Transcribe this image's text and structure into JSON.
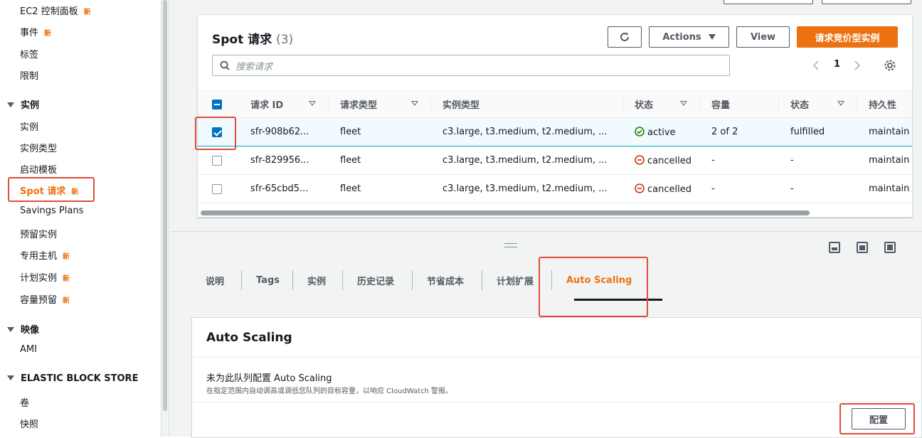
{
  "sidebar": {
    "items": {
      "ec2_dashboard": "EC2 控制面板",
      "events": "事件",
      "tags": "标签",
      "limits": "限制",
      "instances": "实例",
      "instance_types": "实例类型",
      "launch_templates": "启动模板",
      "spot_requests": "Spot 请求",
      "savings_plans": "Savings Plans",
      "reserved_instances": "预留实例",
      "dedicated_hosts": "专用主机",
      "scheduled_instances": "计划实例",
      "capacity_reservations": "容量预留",
      "ami": "AMI",
      "volumes": "卷",
      "snapshots": "快照"
    },
    "sections": {
      "instances": "实例",
      "images": "映像",
      "ebs": "ELASTIC BLOCK STORE"
    },
    "new_badge": "新"
  },
  "spot_panel": {
    "title": "Spot 请求",
    "count": "(3)",
    "actions_label": "Actions",
    "view_label": "View",
    "request_label": "请求竞价型实例",
    "search_placeholder": "搜索请求",
    "page": "1"
  },
  "table": {
    "headers": {
      "request_id": "请求 ID",
      "request_type": "请求类型",
      "instance_type": "实例类型",
      "state": "状态",
      "capacity": "容量",
      "status": "状态",
      "persistence": "持久性"
    },
    "rows": [
      {
        "id": "sfr-908b62...",
        "type": "fleet",
        "instance_types": "c3.large, t3.medium, t2.medium, ...",
        "state": "active",
        "capacity": "2 of 2",
        "status": "fulfilled",
        "persistence": "maintain"
      },
      {
        "id": "sfr-829956...",
        "type": "fleet",
        "instance_types": "c3.large, t3.medium, t2.medium, ...",
        "state": "cancelled",
        "capacity": "-",
        "status": "-",
        "persistence": "maintain"
      },
      {
        "id": "sfr-65cbd5...",
        "type": "fleet",
        "instance_types": "c3.large, t3.medium, t2.medium, ...",
        "state": "cancelled",
        "capacity": "-",
        "status": "-",
        "persistence": "maintain"
      }
    ]
  },
  "tabs": {
    "description": "说明",
    "tags": "Tags",
    "instances": "实例",
    "history": "历史记录",
    "savings": "节省成本",
    "scaling_plan": "计划扩展",
    "auto_scaling": "Auto Scaling"
  },
  "auto_scaling": {
    "title": "Auto Scaling",
    "message": "未为此队列配置 Auto Scaling",
    "description": "在指定范围内自动调高或调低您队列的目标容量，以响应 CloudWatch 警报。",
    "configure_label": "配置"
  },
  "colors": {
    "accent": "#ec7211",
    "link": "#0073bb",
    "success": "#1d8102",
    "error": "#d13212",
    "highlight": "#e04b3a"
  }
}
